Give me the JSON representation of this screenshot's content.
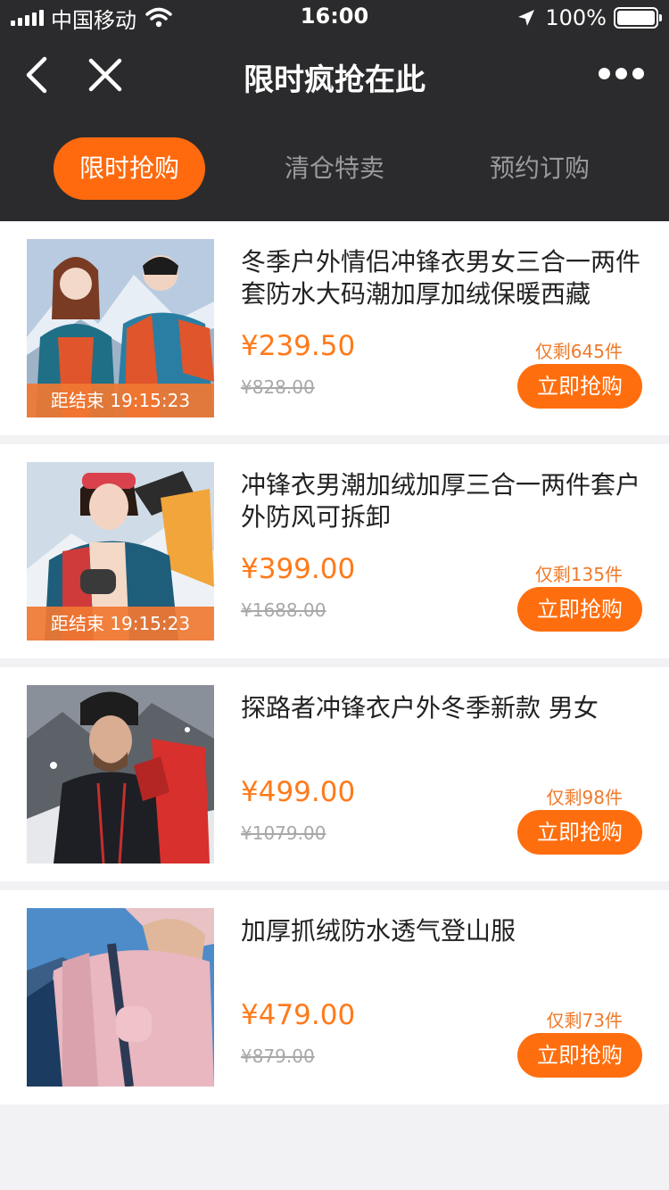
{
  "status": {
    "carrier": "中国移动",
    "time": "16:00",
    "battery": "100%"
  },
  "nav": {
    "title": "限时疯抢在此",
    "back_icon": "chevron-left-icon",
    "close_icon": "close-icon",
    "more_icon": "more-dots-icon"
  },
  "tabs": [
    {
      "label": "限时抢购",
      "active": true
    },
    {
      "label": "清仓特卖",
      "active": false
    },
    {
      "label": "预约订购",
      "active": false
    }
  ],
  "products": [
    {
      "title": "冬季户外情侣冲锋衣男女三合一两件套防水大码潮加厚加绒保暖西藏",
      "price": "¥239.50",
      "original_price": "¥828.00",
      "stock": "仅剩645件",
      "countdown": "距结束 19:15:23",
      "button": "立即抢购"
    },
    {
      "title": "冲锋衣男潮加绒加厚三合一两件套户外防风可拆卸",
      "price": "¥399.00",
      "original_price": "¥1688.00",
      "stock": "仅剩135件",
      "countdown": "距结束 19:15:23",
      "button": "立即抢购"
    },
    {
      "title": "探路者冲锋衣户外冬季新款 男女",
      "price": "¥499.00",
      "original_price": "¥1079.00",
      "stock": "仅剩98件",
      "button": "立即抢购"
    },
    {
      "title": "加厚抓绒防水透气登山服",
      "price": "¥479.00",
      "original_price": "¥879.00",
      "stock": "仅剩73件",
      "button": "立即抢购"
    }
  ],
  "colors": {
    "accent": "#ff6e0e",
    "header_bg": "#2b2b2d",
    "price": "#ff7a1a"
  }
}
